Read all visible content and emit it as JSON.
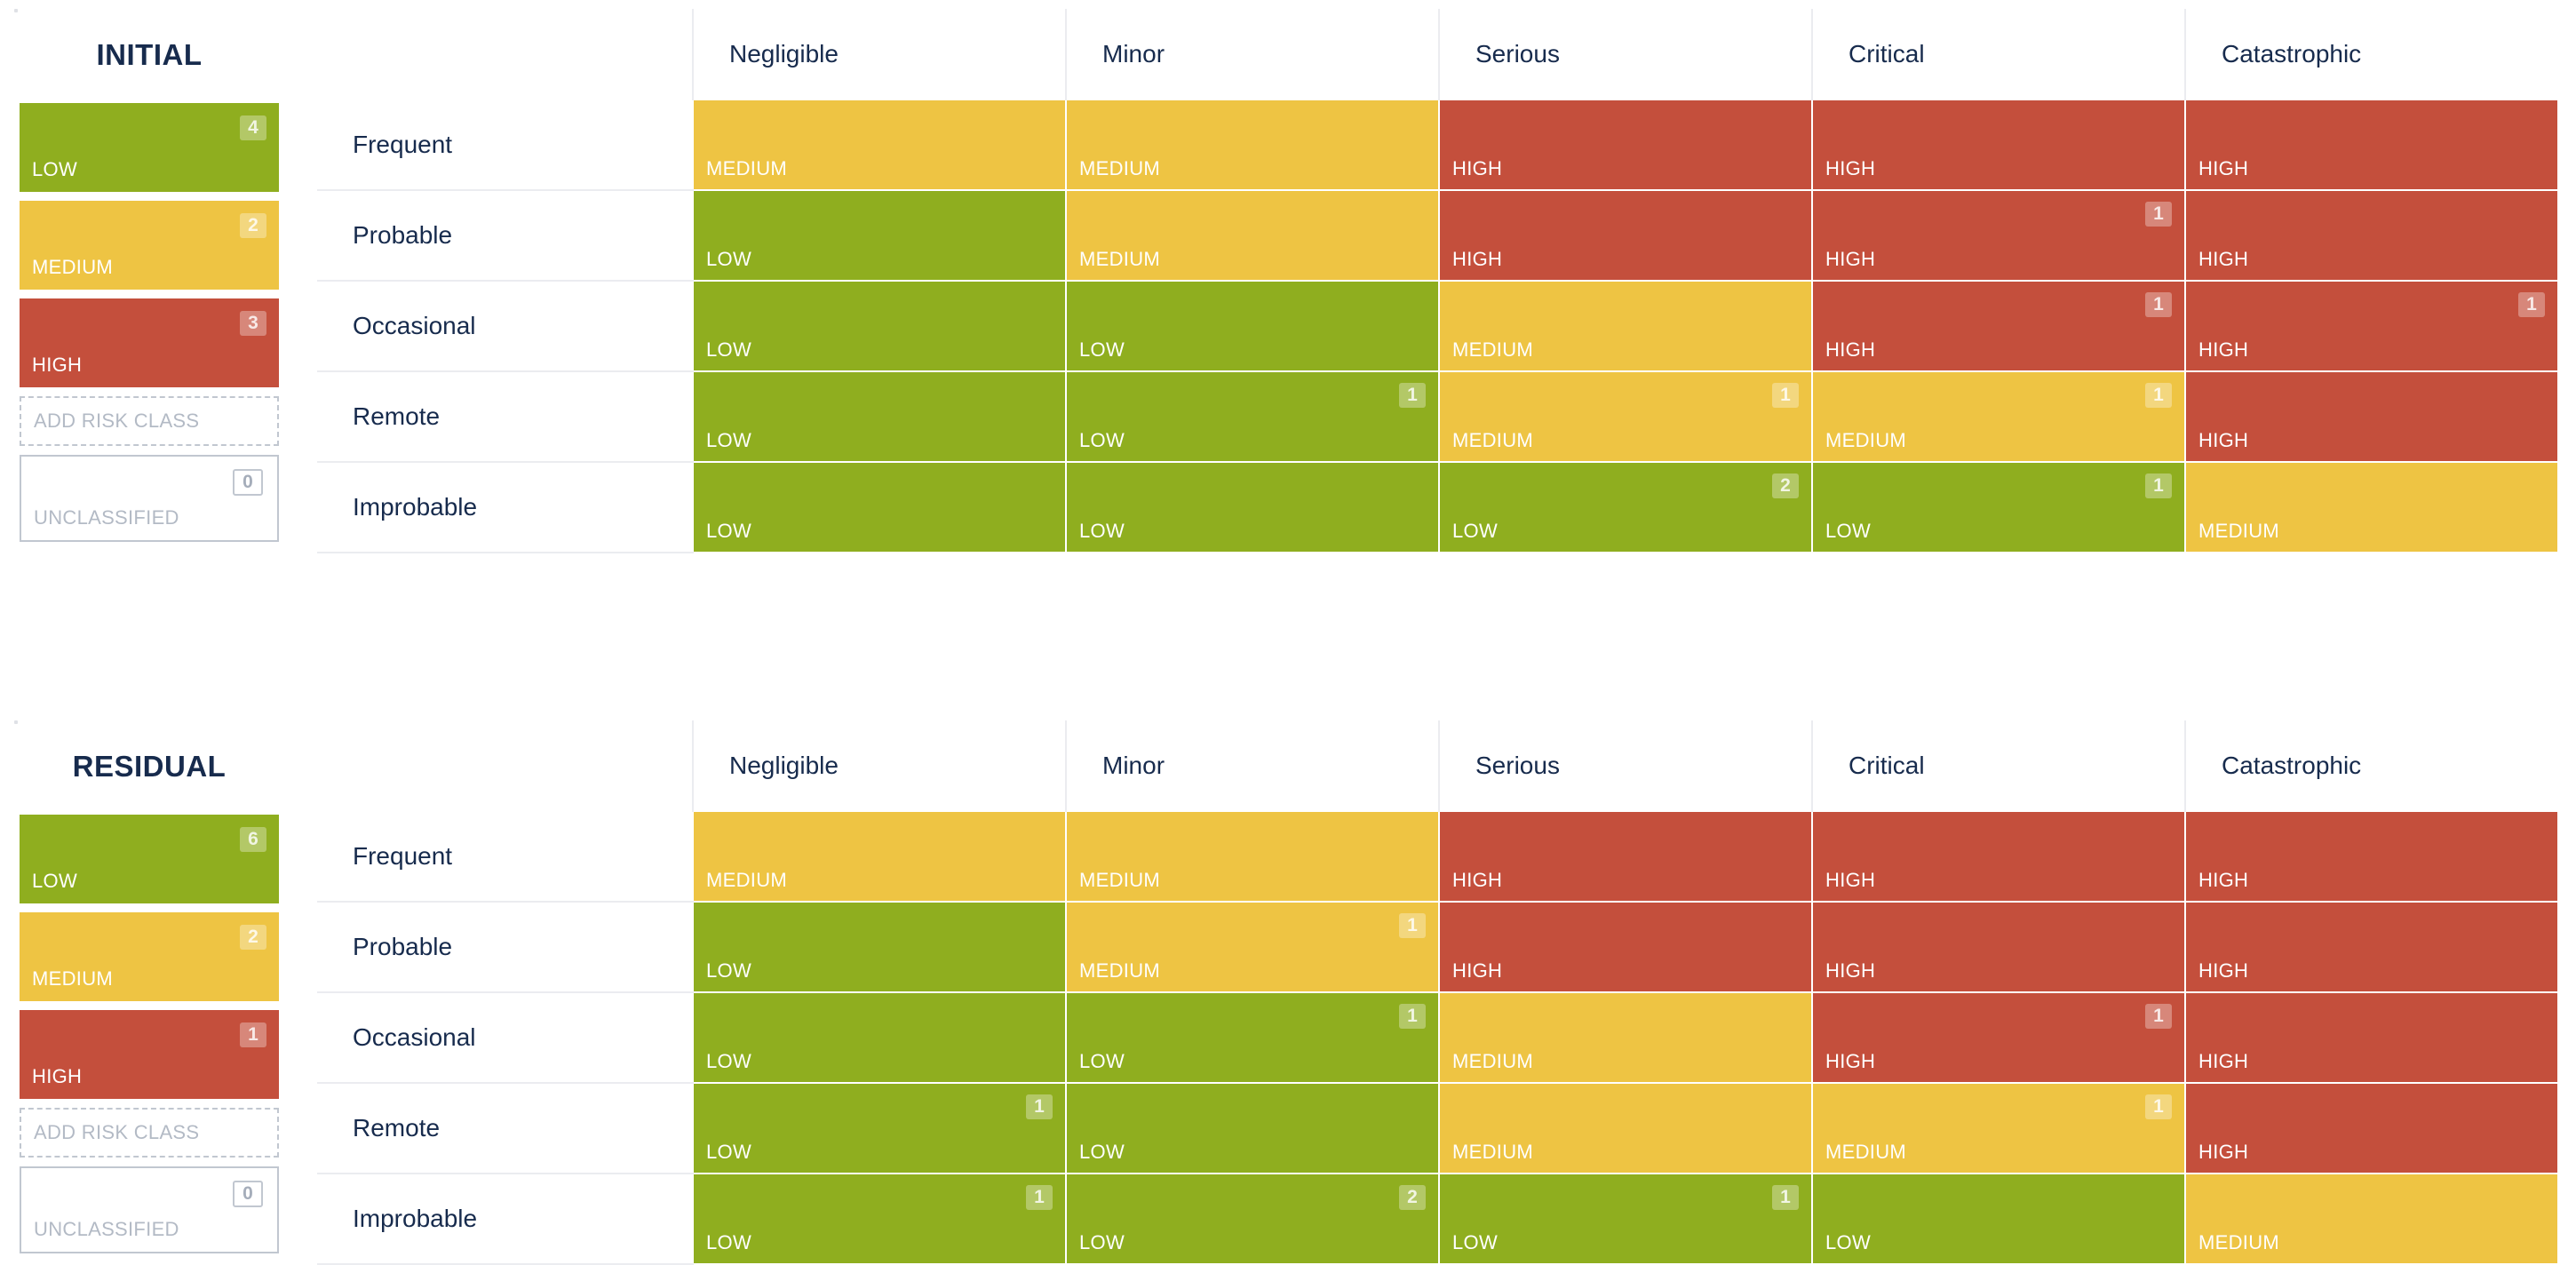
{
  "colors": {
    "low": "#8fae1f",
    "medium": "#eec443",
    "high": "#c44f3c"
  },
  "severities": [
    "Negligible",
    "Minor",
    "Serious",
    "Critical",
    "Catastrophic"
  ],
  "likelihoods": [
    "Frequent",
    "Probable",
    "Occasional",
    "Remote",
    "Improbable"
  ],
  "matrices": [
    {
      "title": "INITIAL",
      "classes": [
        {
          "label": "LOW",
          "count": "4",
          "level": "low"
        },
        {
          "label": "MEDIUM",
          "count": "2",
          "level": "medium"
        },
        {
          "label": "HIGH",
          "count": "3",
          "level": "high"
        }
      ],
      "add_class_label": "ADD RISK CLASS",
      "unclassified": {
        "label": "UNCLASSIFIED",
        "count": "0"
      },
      "rows": [
        {
          "cells": [
            {
              "level": "medium",
              "label": "MEDIUM",
              "count": ""
            },
            {
              "level": "medium",
              "label": "MEDIUM",
              "count": ""
            },
            {
              "level": "high",
              "label": "HIGH",
              "count": ""
            },
            {
              "level": "high",
              "label": "HIGH",
              "count": ""
            },
            {
              "level": "high",
              "label": "HIGH",
              "count": ""
            }
          ]
        },
        {
          "cells": [
            {
              "level": "low",
              "label": "LOW",
              "count": ""
            },
            {
              "level": "medium",
              "label": "MEDIUM",
              "count": ""
            },
            {
              "level": "high",
              "label": "HIGH",
              "count": ""
            },
            {
              "level": "high",
              "label": "HIGH",
              "count": "1"
            },
            {
              "level": "high",
              "label": "HIGH",
              "count": ""
            }
          ]
        },
        {
          "cells": [
            {
              "level": "low",
              "label": "LOW",
              "count": ""
            },
            {
              "level": "low",
              "label": "LOW",
              "count": ""
            },
            {
              "level": "medium",
              "label": "MEDIUM",
              "count": ""
            },
            {
              "level": "high",
              "label": "HIGH",
              "count": "1"
            },
            {
              "level": "high",
              "label": "HIGH",
              "count": "1"
            }
          ]
        },
        {
          "cells": [
            {
              "level": "low",
              "label": "LOW",
              "count": ""
            },
            {
              "level": "low",
              "label": "LOW",
              "count": "1"
            },
            {
              "level": "medium",
              "label": "MEDIUM",
              "count": "1"
            },
            {
              "level": "medium",
              "label": "MEDIUM",
              "count": "1"
            },
            {
              "level": "high",
              "label": "HIGH",
              "count": ""
            }
          ]
        },
        {
          "cells": [
            {
              "level": "low",
              "label": "LOW",
              "count": ""
            },
            {
              "level": "low",
              "label": "LOW",
              "count": ""
            },
            {
              "level": "low",
              "label": "LOW",
              "count": "2"
            },
            {
              "level": "low",
              "label": "LOW",
              "count": "1"
            },
            {
              "level": "medium",
              "label": "MEDIUM",
              "count": ""
            }
          ]
        }
      ]
    },
    {
      "title": "RESIDUAL",
      "classes": [
        {
          "label": "LOW",
          "count": "6",
          "level": "low"
        },
        {
          "label": "MEDIUM",
          "count": "2",
          "level": "medium"
        },
        {
          "label": "HIGH",
          "count": "1",
          "level": "high"
        }
      ],
      "add_class_label": "ADD RISK CLASS",
      "unclassified": {
        "label": "UNCLASSIFIED",
        "count": "0"
      },
      "rows": [
        {
          "cells": [
            {
              "level": "medium",
              "label": "MEDIUM",
              "count": ""
            },
            {
              "level": "medium",
              "label": "MEDIUM",
              "count": ""
            },
            {
              "level": "high",
              "label": "HIGH",
              "count": ""
            },
            {
              "level": "high",
              "label": "HIGH",
              "count": ""
            },
            {
              "level": "high",
              "label": "HIGH",
              "count": ""
            }
          ]
        },
        {
          "cells": [
            {
              "level": "low",
              "label": "LOW",
              "count": ""
            },
            {
              "level": "medium",
              "label": "MEDIUM",
              "count": "1"
            },
            {
              "level": "high",
              "label": "HIGH",
              "count": ""
            },
            {
              "level": "high",
              "label": "HIGH",
              "count": ""
            },
            {
              "level": "high",
              "label": "HIGH",
              "count": ""
            }
          ]
        },
        {
          "cells": [
            {
              "level": "low",
              "label": "LOW",
              "count": ""
            },
            {
              "level": "low",
              "label": "LOW",
              "count": "1"
            },
            {
              "level": "medium",
              "label": "MEDIUM",
              "count": ""
            },
            {
              "level": "high",
              "label": "HIGH",
              "count": "1"
            },
            {
              "level": "high",
              "label": "HIGH",
              "count": ""
            }
          ]
        },
        {
          "cells": [
            {
              "level": "low",
              "label": "LOW",
              "count": "1"
            },
            {
              "level": "low",
              "label": "LOW",
              "count": ""
            },
            {
              "level": "medium",
              "label": "MEDIUM",
              "count": ""
            },
            {
              "level": "medium",
              "label": "MEDIUM",
              "count": "1"
            },
            {
              "level": "high",
              "label": "HIGH",
              "count": ""
            }
          ]
        },
        {
          "cells": [
            {
              "level": "low",
              "label": "LOW",
              "count": "1"
            },
            {
              "level": "low",
              "label": "LOW",
              "count": "2"
            },
            {
              "level": "low",
              "label": "LOW",
              "count": "1"
            },
            {
              "level": "low",
              "label": "LOW",
              "count": ""
            },
            {
              "level": "medium",
              "label": "MEDIUM",
              "count": ""
            }
          ]
        }
      ]
    }
  ]
}
